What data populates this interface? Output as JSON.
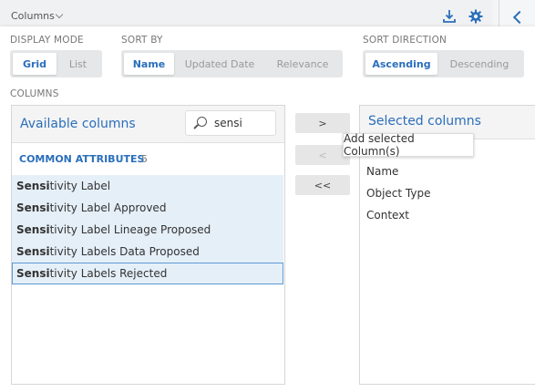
{
  "topbar": {
    "title": "Columns"
  },
  "display_mode": {
    "label": "DISPLAY MODE",
    "options": [
      "Grid",
      "List"
    ],
    "selected": "Grid"
  },
  "sort_by": {
    "label": "SORT BY",
    "options": [
      "Name",
      "Updated Date",
      "Relevance"
    ],
    "selected": "Name"
  },
  "sort_direction": {
    "label": "SORT DIRECTION",
    "options": [
      "Ascending",
      "Descending"
    ],
    "selected": "Ascending"
  },
  "columns_label": "COLUMNS",
  "available": {
    "title": "Available columns",
    "search_value": "sensi",
    "group": {
      "name": "COMMON ATTRIBUTES",
      "count": "5"
    },
    "items": [
      {
        "match": "Sensi",
        "rest": "tivity Label"
      },
      {
        "match": "Sensi",
        "rest": "tivity Label Approved"
      },
      {
        "match": "Sensi",
        "rest": "tivity Label Lineage Proposed"
      },
      {
        "match": "Sensi",
        "rest": "tivity Labels Data Proposed"
      },
      {
        "match": "Sensi",
        "rest": "tivity Labels Rejected"
      }
    ]
  },
  "transfer_buttons": {
    "add": ">",
    "remove": "<",
    "remove_all": "<<"
  },
  "tooltip": "Add selected Column(s)",
  "selected": {
    "title": "Selected columns",
    "items": [
      "Name",
      "Object Type",
      "Context"
    ]
  },
  "colors": {
    "accent": "#2a6ebb",
    "row_selected": "#e5eff8"
  },
  "icons": [
    "chevron-down-icon",
    "download-icon",
    "gear-icon",
    "back-chevron-icon",
    "search-icon"
  ]
}
